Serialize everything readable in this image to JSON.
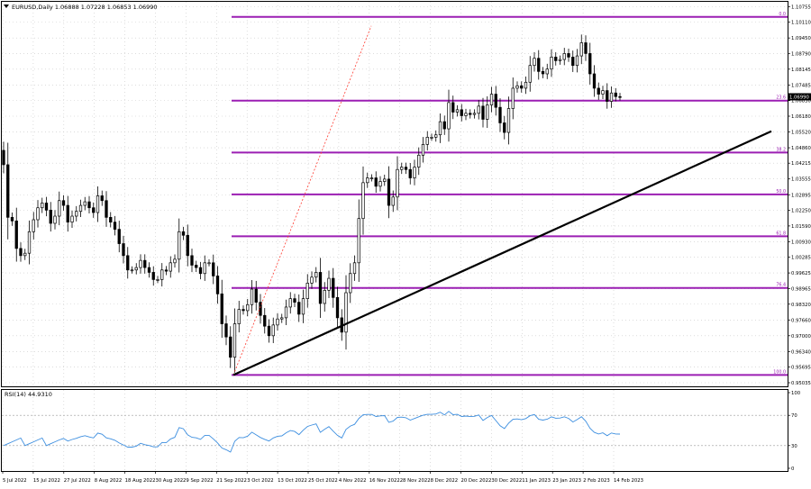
{
  "header": {
    "symbol_line": "EURUSD,Daily  1.06888 1.07228 1.06853 1.06990"
  },
  "rsi_panel": {
    "label": "RSI(14) 44.9310"
  },
  "colors": {
    "background": "#ffffff",
    "candle": "#000000",
    "fib_lines": "#9b1fb3",
    "trendline": "#000000",
    "fib_connector": "#ff3b30",
    "grid": "#c8c8c8",
    "rsi_line": "#3d8fe0",
    "current_price_tag": "#000000"
  },
  "chart_data": [
    {
      "type": "candlestick",
      "symbol": "EURUSD",
      "timeframe": "Daily",
      "ohlc_last": {
        "open": 1.06888,
        "high": 1.07228,
        "low": 1.06853,
        "close": 1.0699
      },
      "ylim": [
        0.95035,
        1.10755
      ],
      "y_ticks": [
        "1.10755",
        "1.10110",
        "1.09450",
        "1.08790",
        "1.08145",
        "1.07485",
        "1.06830",
        "1.06180",
        "1.05520",
        "1.04860",
        "1.04215",
        "1.03555",
        "1.02895",
        "1.02250",
        "1.01590",
        "1.00930",
        "1.00285",
        "0.99625",
        "0.98965",
        "0.98320",
        "0.97660",
        "0.97000",
        "0.96340",
        "0.95695",
        "0.95035"
      ],
      "x_ticks": [
        "5 Jul 2022",
        "15 Jul 2022",
        "27 Jul 2022",
        "8 Aug 2022",
        "18 Aug 2022",
        "30 Aug 2022",
        "9 Sep 2022",
        "21 Sep 2022",
        "3 Oct 2022",
        "13 Oct 2022",
        "25 Oct 2022",
        "4 Nov 2022",
        "16 Nov 2022",
        "28 Nov 2022",
        "8 Dec 2022",
        "20 Dec 2022",
        "30 Dec 2022",
        "11 Jan 2023",
        "23 Jan 2023",
        "2 Feb 2023",
        "14 Feb 2023"
      ],
      "current_price_label": "1.06990",
      "close_series": [
        1.0415,
        1.0195,
        1.018,
        1.0065,
        1.0035,
        1.0045,
        1.0135,
        1.0185,
        1.0235,
        1.0255,
        1.0225,
        1.017,
        1.02,
        1.0265,
        1.0245,
        1.0175,
        1.02,
        1.022,
        1.0245,
        1.026,
        1.0235,
        1.0215,
        1.0285,
        1.0265,
        1.0195,
        1.0175,
        1.0145,
        1.0085,
        1.0035,
        0.9975,
        0.9975,
        0.9985,
        1.0015,
        0.9985,
        0.9965,
        0.9935,
        0.9935,
        0.9975,
        0.997,
        1.0005,
        1.002,
        1.0135,
        1.012,
        1.0035,
        0.9995,
        0.9985,
        0.996,
        1.0005,
        1.0005,
        0.995,
        0.9875,
        0.975,
        0.9695,
        0.961,
        0.975,
        0.981,
        0.9805,
        0.983,
        0.9895,
        0.984,
        0.9785,
        0.974,
        0.97,
        0.9745,
        0.977,
        0.9775,
        0.982,
        0.9855,
        0.984,
        0.979,
        0.9855,
        0.992,
        0.9945,
        0.9965,
        0.9835,
        0.989,
        0.994,
        0.986,
        0.9775,
        0.9715,
        0.988,
        0.996,
        1.0005,
        1.019,
        1.034,
        1.036,
        1.036,
        1.0325,
        1.0345,
        1.0355,
        1.0245,
        1.028,
        1.0395,
        1.0405,
        1.0395,
        1.036,
        1.0405,
        1.0455,
        1.05,
        1.053,
        1.053,
        1.054,
        1.0595,
        1.0565,
        1.0675,
        1.0635,
        1.0645,
        1.062,
        1.063,
        1.0625,
        1.063,
        1.066,
        1.0605,
        1.0665,
        1.071,
        1.0655,
        1.059,
        1.055,
        1.065,
        1.0735,
        1.0745,
        1.0735,
        1.076,
        1.083,
        1.086,
        1.0805,
        1.0795,
        1.0815,
        1.0865,
        1.085,
        1.0855,
        1.088,
        1.0865,
        1.083,
        1.087,
        1.0925,
        1.088,
        1.0795,
        1.0735,
        1.071,
        1.0725,
        1.068,
        1.0715,
        1.07,
        1.0699
      ],
      "fibonacci_retracement": {
        "levels": [
          {
            "label": "0.0",
            "price": 1.1033
          },
          {
            "label": "23.6",
            "price": 1.0683
          },
          {
            "label": "38.2",
            "price": 1.0466
          },
          {
            "label": "50.0",
            "price": 1.0291
          },
          {
            "label": "61.8",
            "price": 1.0116
          },
          {
            "label": "76.4",
            "price": 0.99
          },
          {
            "label": "100.0",
            "price": 0.9536
          }
        ]
      },
      "trendline": {
        "from": {
          "date": "26 Sep 2022",
          "price": 0.9536
        },
        "to": {
          "date": "24 Feb 2023",
          "price": 1.0555
        }
      }
    },
    {
      "type": "line",
      "name": "RSI(14)",
      "last_value": 44.931,
      "ylim": [
        0,
        100
      ],
      "y_ticks": [
        "100",
        "70",
        "30",
        "0"
      ],
      "levels": [
        70,
        30
      ]
    }
  ]
}
